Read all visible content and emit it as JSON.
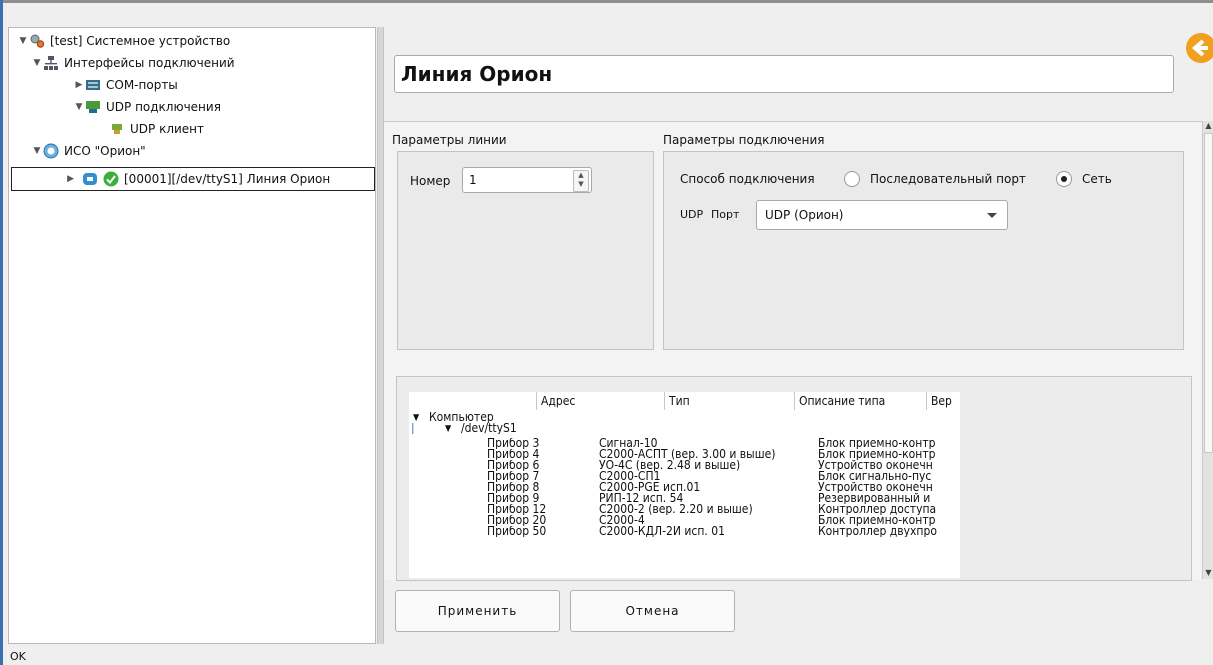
{
  "tree": {
    "root": "[test] Системное устройство",
    "interfaces": "Интерфейсы подключений",
    "com_ports": "COM-порты",
    "udp_connections": "UDP подключения",
    "udp_client": "UDP клиент",
    "iso": "ИСО \"Орион\"",
    "line": "[00001][/dev/ttyS1] Линия Орион"
  },
  "header": {
    "title": "Линия Орион"
  },
  "line_params": {
    "title": "Параметры линии",
    "number_label": "Номер",
    "number_value": "1"
  },
  "connection_params": {
    "title": "Параметры подключения",
    "method_label": "Способ подключения",
    "option_serial": "Последовательный порт",
    "option_network": "Сеть",
    "selected": "Сеть",
    "udp_label": "UDP",
    "port_label": "Порт",
    "port_value": "UDP (Орион)"
  },
  "devices": {
    "columns": [
      "Адрес",
      "Тип",
      "Описание типа",
      "Вер"
    ],
    "computer": "Компьютер",
    "port": "/dev/ttyS1",
    "rows": [
      {
        "addr": "Прибор 3",
        "type": "Сигнал-10",
        "desc": "Блок приемно-контр"
      },
      {
        "addr": "Прибор 4",
        "type": "С2000-АСПТ (вер. 3.00 и выше)",
        "desc": "Блок приемно-контр"
      },
      {
        "addr": "Прибор 6",
        "type": "УО-4С (вер. 2.48 и выше)",
        "desc": "Устройство оконечн"
      },
      {
        "addr": "Прибор 7",
        "type": "С2000-СП1",
        "desc": "Блок сигнально-пус"
      },
      {
        "addr": "Прибор 8",
        "type": "С2000-PGE исп.01",
        "desc": "Устройство оконечн"
      },
      {
        "addr": "Прибор 9",
        "type": "РИП-12 исп. 54",
        "desc": "Резервированный и"
      },
      {
        "addr": "Прибор 12",
        "type": "С2000-2 (вер. 2.20 и выше)",
        "desc": "Контроллер доступа"
      },
      {
        "addr": "Прибор 20",
        "type": "С2000-4",
        "desc": "Блок приемно-контр"
      },
      {
        "addr": "Прибор 50",
        "type": "С2000-КДЛ-2И исп. 01",
        "desc": "Контроллер двухпро"
      }
    ]
  },
  "buttons": {
    "apply": "Применить",
    "cancel": "Отмена"
  },
  "status": "OK",
  "colors": {
    "accent": "#3d6fb1",
    "back_button": "#f0a020",
    "ok_check": "#3cb03c"
  }
}
